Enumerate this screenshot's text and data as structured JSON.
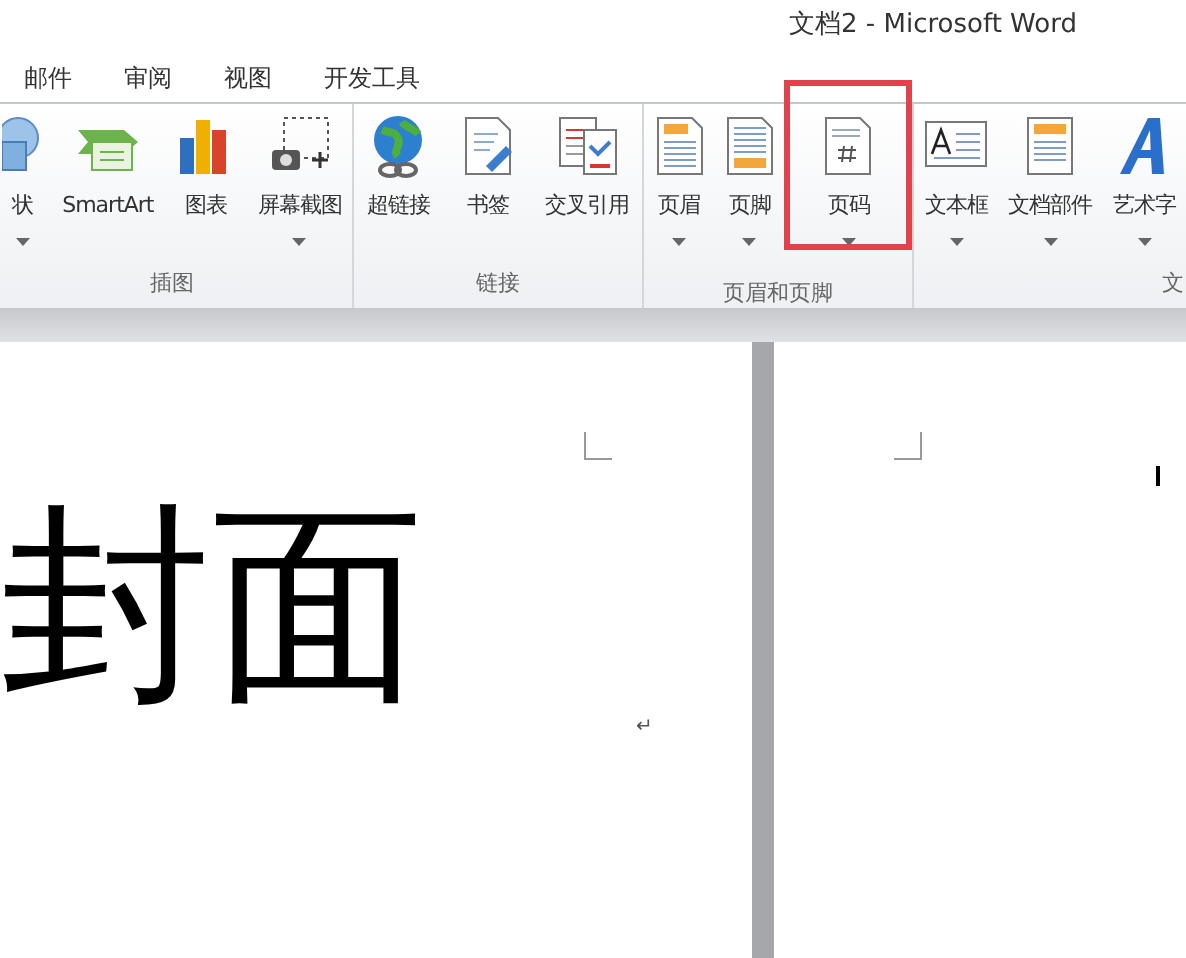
{
  "window": {
    "title": "文档2 - Microsoft Word"
  },
  "tabs": [
    {
      "label": "邮件",
      "selected": false
    },
    {
      "label": "审阅",
      "selected": false
    },
    {
      "label": "视图",
      "selected": false
    },
    {
      "label": "开发工具",
      "selected": false
    }
  ],
  "ribbon": {
    "groups": [
      {
        "label": "插图",
        "buttons": [
          {
            "label": "状",
            "dropdown": true,
            "highlighted": false
          },
          {
            "label": "SmartArt",
            "dropdown": false,
            "highlighted": false
          },
          {
            "label": "图表",
            "dropdown": false,
            "highlighted": false
          },
          {
            "label": "屏幕截图",
            "dropdown": true,
            "highlighted": false
          }
        ]
      },
      {
        "label": "链接",
        "buttons": [
          {
            "label": "超链接",
            "dropdown": false,
            "highlighted": false
          },
          {
            "label": "书签",
            "dropdown": false,
            "highlighted": false
          },
          {
            "label": "交叉引用",
            "dropdown": false,
            "highlighted": false
          }
        ]
      },
      {
        "label": "页眉和页脚",
        "buttons": [
          {
            "label": "页眉",
            "dropdown": true,
            "highlighted": false
          },
          {
            "label": "页脚",
            "dropdown": true,
            "highlighted": false
          },
          {
            "label": "页码",
            "dropdown": true,
            "highlighted": true
          }
        ]
      },
      {
        "label": "文",
        "buttons": [
          {
            "label": "文本框",
            "dropdown": true,
            "highlighted": false
          },
          {
            "label": "文档部件",
            "dropdown": true,
            "highlighted": false
          },
          {
            "label": "艺术字",
            "dropdown": true,
            "highlighted": false
          }
        ]
      }
    ]
  },
  "document": {
    "cover_text": "封面",
    "paragraph_mark": "↵"
  }
}
